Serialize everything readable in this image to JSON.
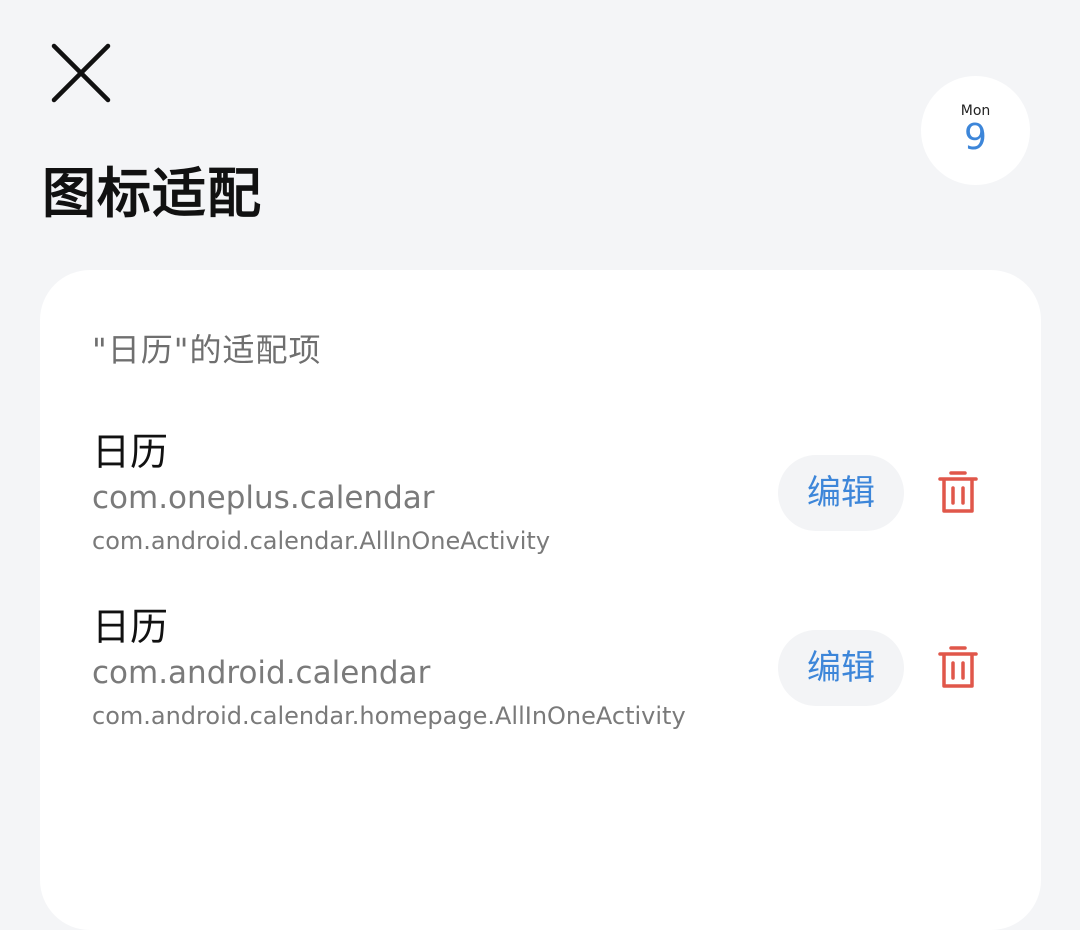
{
  "header": {
    "close_icon": "close-icon",
    "title": "图标适配"
  },
  "app_icon": {
    "day_of_week": "Mon",
    "day": "9",
    "accent": "#3d86d9"
  },
  "card": {
    "section_title": "\"日历\"的适配项",
    "entries": [
      {
        "name": "日历",
        "package": "com.oneplus.calendar",
        "activity": "com.android.calendar.AllInOneActivity",
        "edit_label": "编辑",
        "delete_icon": "trash-icon"
      },
      {
        "name": "日历",
        "package": "com.android.calendar",
        "activity": "com.android.calendar.homepage.AllInOneActivity",
        "edit_label": "编辑",
        "delete_icon": "trash-icon"
      }
    ]
  },
  "colors": {
    "background": "#f4f5f7",
    "card": "#ffffff",
    "accent": "#3d86d9",
    "delete": "#e0574a"
  }
}
